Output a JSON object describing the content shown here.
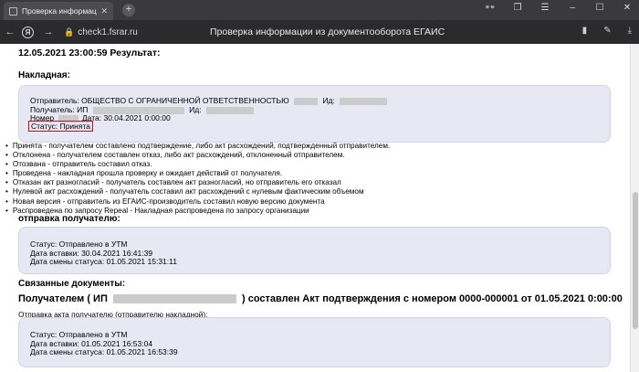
{
  "browser": {
    "tab_title": "Проверка информаци",
    "tab_close": "✕",
    "new_tab": "+",
    "url": "check1.fsrar.ru",
    "page_title": "Проверка информации из документооборота ЕГАИС",
    "back": "←",
    "forward": "→",
    "yandex_letter": "Я",
    "lock": "🔒",
    "icons": [
      "bookmark-icon",
      "extensions-icon",
      "downloads-icon",
      "menu-icon",
      "minimize-icon",
      "maximize-icon",
      "close-icon"
    ]
  },
  "result": {
    "heading": "12.05.2021 23:00:59 Результат:"
  },
  "invoice": {
    "heading": "Накладная:",
    "sender_label": "Отправитель: ОБЩЕСТВО С ОГРАНИЧЕННОЙ ОТВЕТСТВЕННОСТЬЮ",
    "sender_id_label": "Ид:",
    "receiver_label": "Получатель: ИП",
    "receiver_id_label": "Ид:",
    "number_label": "Номер",
    "date_text": "Дата: 30.04.2021 0:00:00",
    "status_text": "Статус: Принята"
  },
  "legend": [
    "Принята - получателем составлено подтверждение, либо акт расхождений, подтвержденный отправителем.",
    "Отклонена - получателем составлен отказ, либо акт расхождений, отклоненный отправителем.",
    "Отозвана - отправитель составил отказ.",
    "Проведена - накладная прошла проверку и ожидает действий от получателя.",
    "Отказан акт разногласий - получатель составлен акт разногласий, но отправитель его отказал",
    "Нулевой акт расхождений - получатель составил акт расхождений с нулевым фактическим объемом",
    "Новая версия - отправитель из ЕГАИС-производитель составил новую версию документа",
    "Распроведена по запросу Repeal - Накладная распроведена по запросу организации"
  ],
  "sending": {
    "heading": "отправка получателю:",
    "status": "Статус: Отправлено в УТМ",
    "inserted": "Дата вставки: 30.04.2021 16:41:39",
    "changed": "Дата смены статуса: 01.05.2021 15:31:11"
  },
  "related": {
    "heading": "Связанные документы:",
    "big_prefix": "Получателем ( ИП",
    "big_suffix": ") составлен Акт подтверждения с номером 0000-000001 от 01.05.2021 0:00:00",
    "note": "Отправка акта получателю (отправителю накладной):",
    "status": "Статус: Отправлено в УТМ",
    "inserted": "Дата вставки: 01.05.2021 16:53:04",
    "changed": "Дата смены статуса: 01.05.2021 16:53:39"
  },
  "colors": {
    "panel_bg": "#e8e8f5",
    "status_border": "#cc1111",
    "chrome_dark": "#2b2b2e"
  }
}
